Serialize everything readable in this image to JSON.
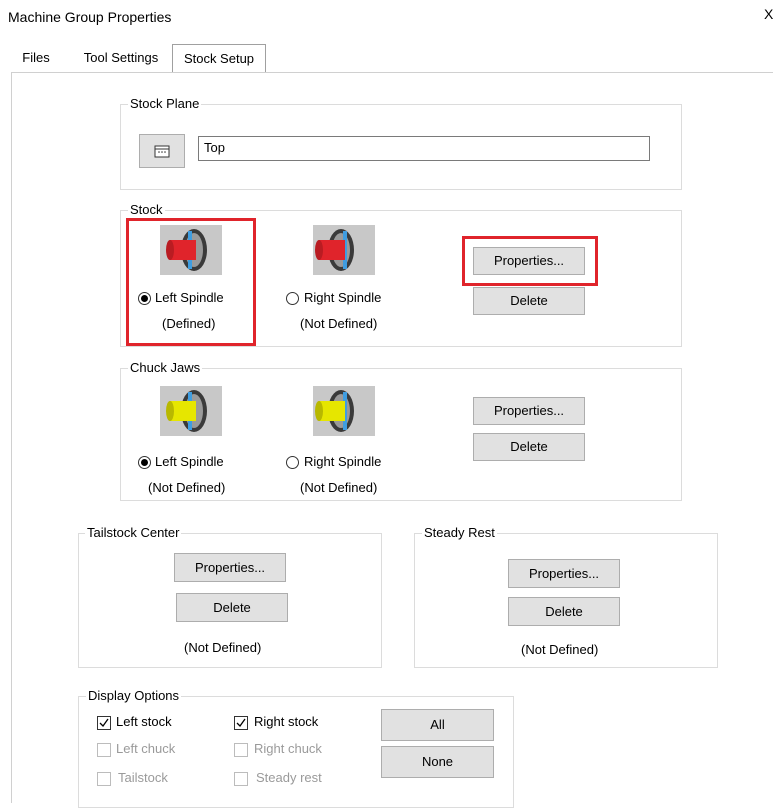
{
  "window": {
    "title": "Machine Group Properties",
    "close_glyph": "X"
  },
  "tabs": [
    {
      "label": "Files",
      "active": false
    },
    {
      "label": "Tool Settings",
      "active": false
    },
    {
      "label": "Stock Setup",
      "active": true
    }
  ],
  "stock_plane": {
    "legend": "Stock Plane",
    "value": "Top",
    "button_icon": "plane-select-icon"
  },
  "stock": {
    "legend": "Stock",
    "left": {
      "radio_label": "Left Spindle",
      "status": "(Defined)",
      "selected": true,
      "icon": "stock-left-spindle-icon"
    },
    "right": {
      "radio_label": "Right Spindle",
      "status": "(Not Defined)",
      "selected": false,
      "icon": "stock-right-spindle-icon"
    },
    "properties_label": "Properties...",
    "delete_label": "Delete"
  },
  "chuck_jaws": {
    "legend": "Chuck Jaws",
    "left": {
      "radio_label": "Left Spindle",
      "status": "(Not Defined)",
      "selected": true,
      "icon": "chuck-left-spindle-icon"
    },
    "right": {
      "radio_label": "Right Spindle",
      "status": "(Not Defined)",
      "selected": false,
      "icon": "chuck-right-spindle-icon"
    },
    "properties_label": "Properties...",
    "delete_label": "Delete"
  },
  "tailstock_center": {
    "legend": "Tailstock Center",
    "properties_label": "Properties...",
    "delete_label": "Delete",
    "status": "(Not Defined)"
  },
  "steady_rest": {
    "legend": "Steady Rest",
    "properties_label": "Properties...",
    "delete_label": "Delete",
    "status": "(Not Defined)"
  },
  "display_options": {
    "legend": "Display Options",
    "left_stock": {
      "label": "Left stock",
      "checked": true,
      "enabled": true
    },
    "right_stock": {
      "label": "Right stock",
      "checked": true,
      "enabled": true
    },
    "left_chuck": {
      "label": "Left chuck",
      "checked": false,
      "enabled": false
    },
    "right_chuck": {
      "label": "Right chuck",
      "checked": false,
      "enabled": false
    },
    "tailstock": {
      "label": "Tailstock",
      "checked": false,
      "enabled": false
    },
    "steady_rest": {
      "label": "Steady rest",
      "checked": false,
      "enabled": false
    },
    "all_label": "All",
    "none_label": "None"
  },
  "colors": {
    "highlight": "#e0242b",
    "button_face": "#e1e1e1",
    "stock_red": "#e0242b",
    "chuck_yellow": "#e6e600",
    "check_mark": "#000000"
  }
}
